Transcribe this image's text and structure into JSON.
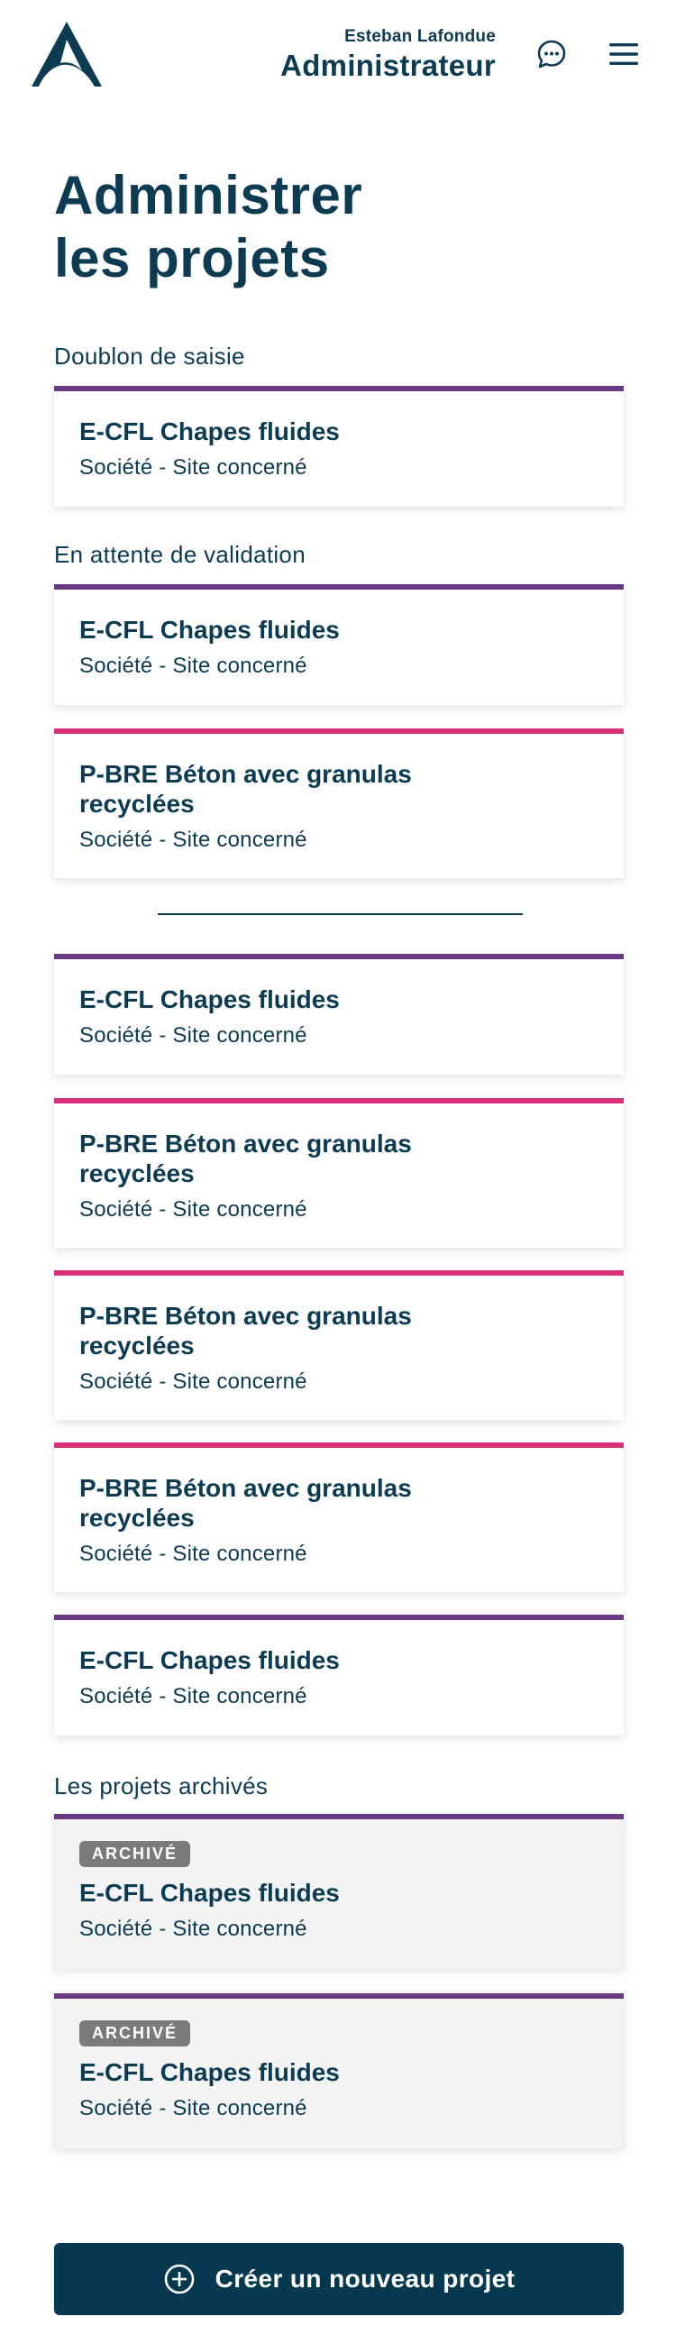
{
  "header": {
    "user_name": "Esteban Lafondue",
    "user_role": "Administrateur",
    "icons": {
      "logo": "triangle-logo-icon",
      "chat": "chat-bubble-icon",
      "menu": "hamburger-menu-icon"
    }
  },
  "page": {
    "title_line1": "Administrer",
    "title_line2": "les projets"
  },
  "sections": {
    "duplicate": "Doublon de saisie",
    "pending": "En attente de validation",
    "archived": "Les projets archivés"
  },
  "cards": {
    "c1": {
      "title": "E-CFL Chapes fluides",
      "sub": "Société - Site concerné"
    },
    "c2": {
      "title": "E-CFL Chapes fluides",
      "sub": "Société - Site concerné"
    },
    "c3": {
      "title": "P-BRE Béton avec granulas recyclées",
      "sub": "Société - Site concerné"
    },
    "c4": {
      "title": "E-CFL Chapes fluides",
      "sub": "Société - Site concerné"
    },
    "c5": {
      "title": "P-BRE Béton avec granulas recyclées",
      "sub": "Société - Site concerné"
    },
    "c6": {
      "title": "P-BRE Béton avec granulas recyclées",
      "sub": "Société - Site concerné"
    },
    "c7": {
      "title": "P-BRE Béton avec granulas recyclées",
      "sub": "Société - Site concerné"
    },
    "c8": {
      "title": "E-CFL Chapes fluides",
      "sub": "Société - Site concerné"
    },
    "a1": {
      "badge": "ARCHIVÉ",
      "title": "E-CFL Chapes fluides",
      "sub": "Société - Site concerné"
    },
    "a2": {
      "badge": "ARCHIVÉ",
      "title": "E-CFL Chapes fluides",
      "sub": "Société - Site concerné"
    }
  },
  "actions": {
    "create_label": "Créer un nouveau projet",
    "create_icon": "plus-circle-icon"
  },
  "colors": {
    "primary": "#0d3b52",
    "button": "#06384f",
    "purple_accent": "#6b3a86",
    "pink_accent": "#d8317c",
    "badge": "#7a7a7a"
  }
}
